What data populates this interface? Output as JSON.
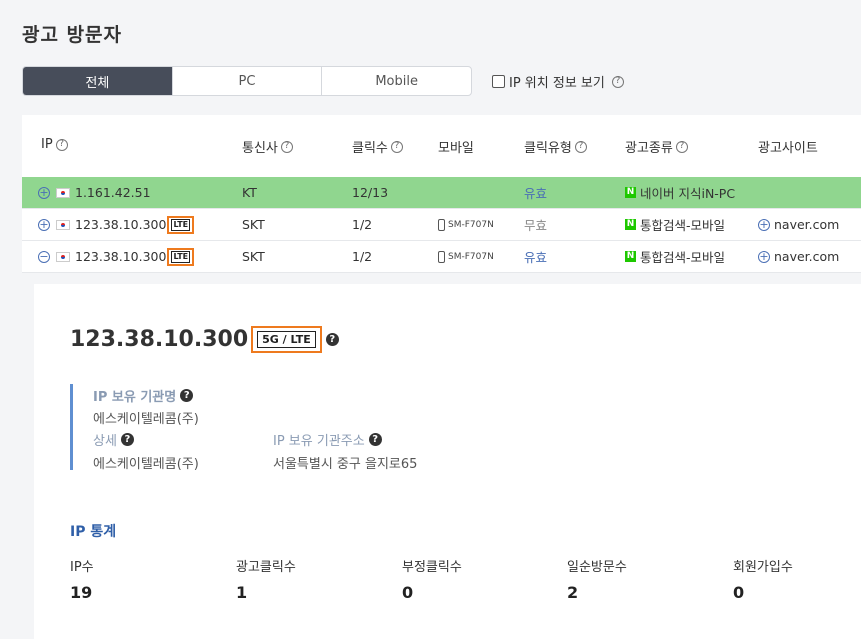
{
  "page": {
    "title": "광고 방문자"
  },
  "tabs": [
    {
      "label": "전체",
      "active": true
    },
    {
      "label": "PC",
      "active": false
    },
    {
      "label": "Mobile",
      "active": false
    }
  ],
  "ip_geo_toggle": {
    "label": "IP 위치 정보 보기",
    "checked": false
  },
  "table": {
    "headers": [
      "IP",
      "통신사",
      "클릭수",
      "모바일",
      "클릭유형",
      "광고종류",
      "광고사이트"
    ],
    "rows": [
      {
        "expand": "+",
        "ip": "1.161.42.51",
        "lte": "",
        "carrier": "KT",
        "clicks": "12/13",
        "mobile": "",
        "click_type": "유효",
        "ad_type": "네이버 지식iN-PC",
        "site": ""
      },
      {
        "expand": "+",
        "ip": "123.38.10.300",
        "lte": "LTE",
        "carrier": "SKT",
        "clicks": "1/2",
        "mobile": "SM-F707N",
        "click_type": "무효",
        "ad_type": "통합검색-모바일",
        "site": "naver.com"
      },
      {
        "expand": "−",
        "ip": "123.38.10.300",
        "lte": "LTE",
        "carrier": "SKT",
        "clicks": "1/2",
        "mobile": "SM-F707N",
        "click_type": "유효",
        "ad_type": "통합검색-모바일",
        "site": "naver.com"
      }
    ]
  },
  "detail": {
    "ip": "123.38.10.300",
    "network_tag": "5G / LTE",
    "owner_label": "IP 보유 기관명",
    "owner_value": "에스케이텔레콤(주)",
    "detail_label": "상세",
    "detail_value": "에스케이텔레콤(주)",
    "address_label": "IP 보유 기관주소",
    "address_value": "서울특별시 중구 을지로65"
  },
  "stats": {
    "title": "IP 통계",
    "items": [
      {
        "label": "IP수",
        "value": "19"
      },
      {
        "label": "광고클릭수",
        "value": "1"
      },
      {
        "label": "부정클릭수",
        "value": "0"
      },
      {
        "label": "일순방문수",
        "value": "2"
      },
      {
        "label": "회원가입수",
        "value": "0"
      }
    ]
  },
  "colors": {
    "highlight_row": "#90d68f",
    "accent_orange": "#ee7a1e",
    "link_blue": "#4a6fb5",
    "naver_green": "#1ec800"
  }
}
